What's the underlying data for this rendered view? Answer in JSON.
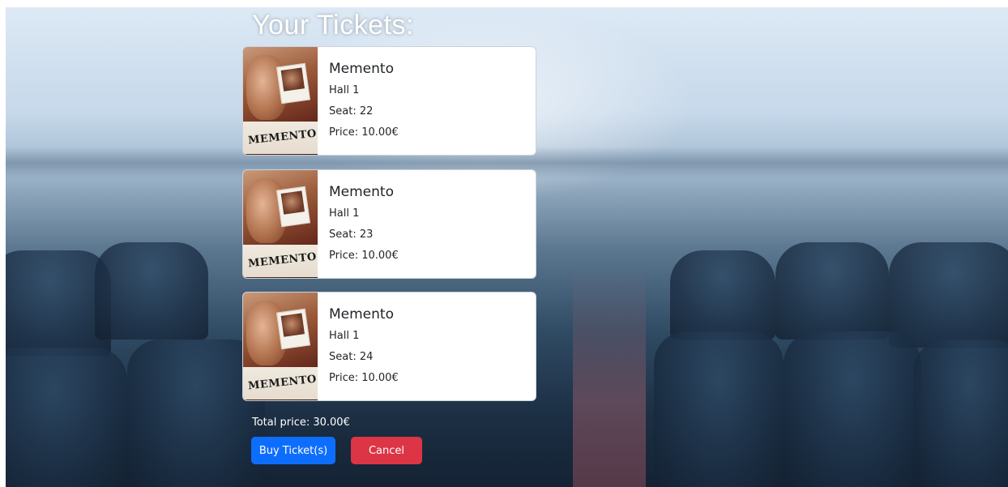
{
  "page": {
    "title": "Your Tickets:"
  },
  "tickets": [
    {
      "movie": "Memento",
      "hall": "Hall 1",
      "seat": "Seat: 22",
      "price": "Price: 10.00€",
      "poster_text": "MEMENTO"
    },
    {
      "movie": "Memento",
      "hall": "Hall 1",
      "seat": "Seat: 23",
      "price": "Price: 10.00€",
      "poster_text": "MEMENTO"
    },
    {
      "movie": "Memento",
      "hall": "Hall 1",
      "seat": "Seat: 24",
      "price": "Price: 10.00€",
      "poster_text": "MEMENTO"
    }
  ],
  "summary": {
    "total_price": "Total price: 30.00€"
  },
  "actions": {
    "buy_label": "Buy Ticket(s)",
    "cancel_label": "Cancel"
  },
  "colors": {
    "primary": "#0d6efd",
    "danger": "#dc3545",
    "card_background": "#ffffff"
  }
}
